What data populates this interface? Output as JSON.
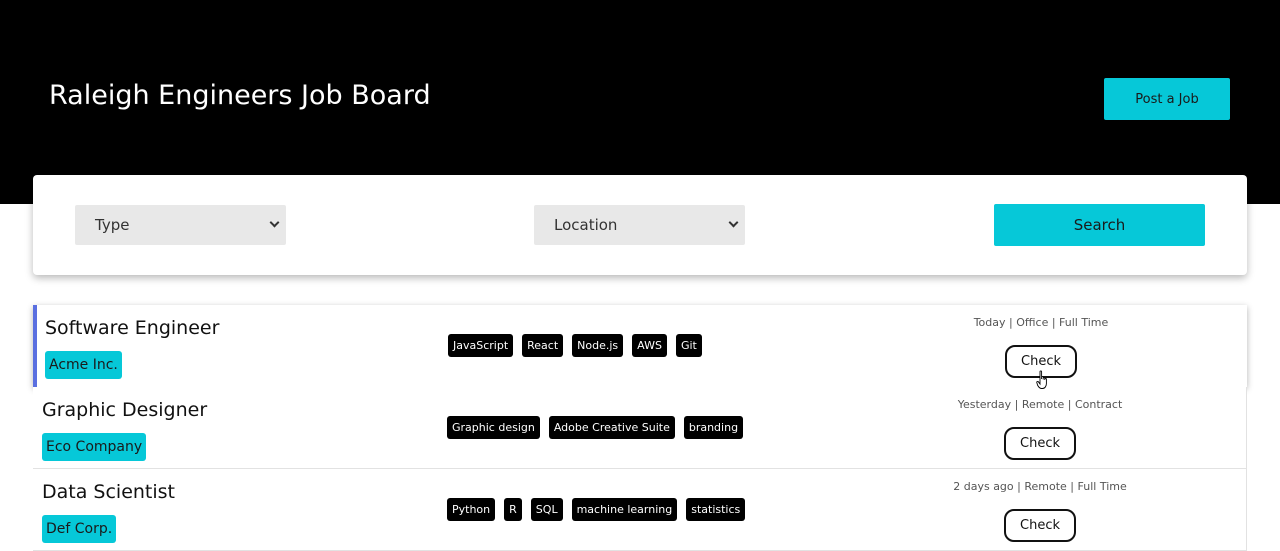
{
  "header": {
    "title": "Raleigh Engineers Job Board",
    "post_job_label": "Post a Job"
  },
  "search": {
    "type_label": "Type",
    "location_label": "Location",
    "search_label": "Search"
  },
  "jobs": [
    {
      "title": "Software Engineer",
      "company": "Acme Inc.",
      "tags": [
        "JavaScript",
        "React",
        "Node.js",
        "AWS",
        "Git"
      ],
      "posted": "Today",
      "location": "Office",
      "employment": "Full Time",
      "check_label": "Check"
    },
    {
      "title": "Graphic Designer",
      "company": "Eco Company",
      "tags": [
        "Graphic design",
        "Adobe Creative Suite",
        "branding"
      ],
      "posted": "Yesterday",
      "location": "Remote",
      "employment": "Contract",
      "check_label": "Check"
    },
    {
      "title": "Data Scientist",
      "company": "Def Corp.",
      "tags": [
        "Python",
        "R",
        "SQL",
        "machine learning",
        "statistics"
      ],
      "posted": "2 days ago",
      "location": "Remote",
      "employment": "Full Time",
      "check_label": "Check"
    }
  ],
  "colors": {
    "accent": "#06c8d8",
    "header_bg": "#000000",
    "active_border": "#5a6fe0"
  }
}
